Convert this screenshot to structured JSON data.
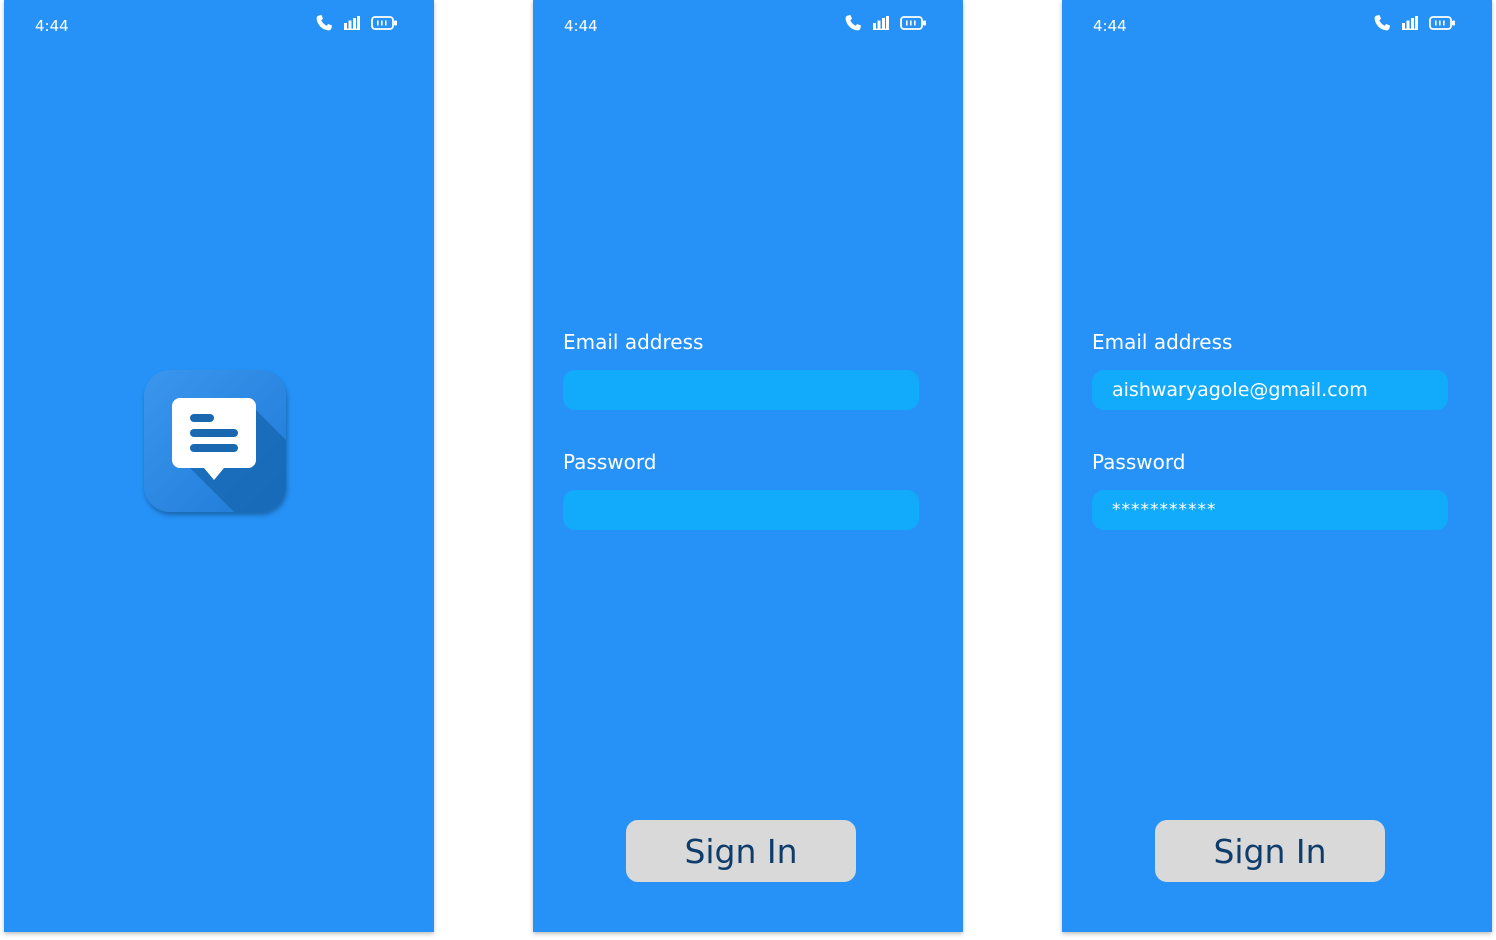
{
  "status_bar": {
    "time": "4:44",
    "icons": [
      "phone-icon",
      "signal-icon",
      "battery-icon"
    ]
  },
  "colors": {
    "screen_background": "#2692f7",
    "input_background": "#12abfc",
    "button_background": "#d9d9d9",
    "button_text": "#0f3d6b",
    "logo_background": "#2f8ae6",
    "logo_bubble": "#ffffff",
    "logo_lines": "#1a68b0"
  },
  "splash": {
    "logo_icon": "message-bubble-icon"
  },
  "login_empty": {
    "email_label": "Email address",
    "email_value": "",
    "password_label": "Password",
    "password_value": "",
    "signin_label": "Sign In"
  },
  "login_filled": {
    "email_label": "Email address",
    "email_value": "aishwaryagole@gmail.com",
    "password_label": "Password",
    "password_value": "***********",
    "signin_label": "Sign In"
  }
}
